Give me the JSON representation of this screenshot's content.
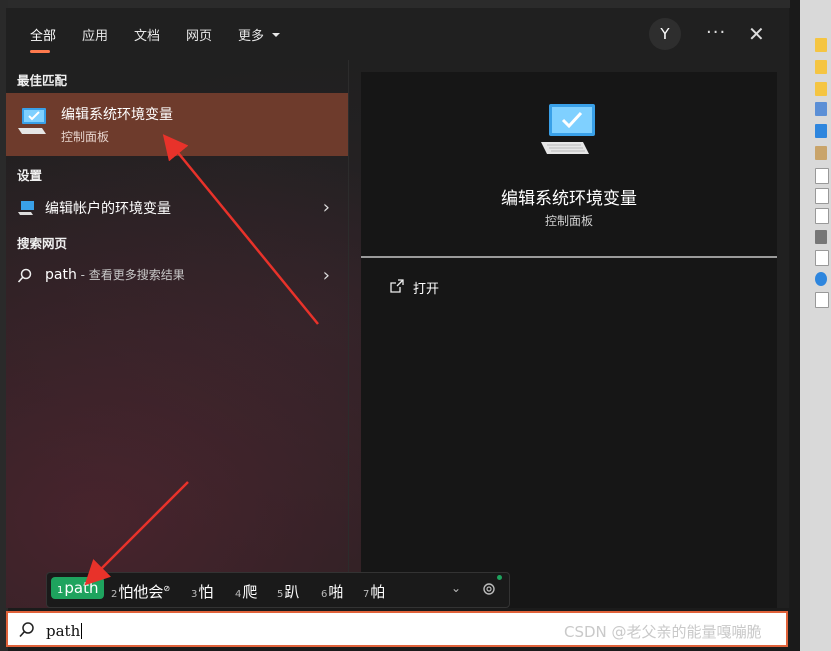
{
  "tabs": [
    {
      "label": "全部",
      "active": true
    },
    {
      "label": "应用"
    },
    {
      "label": "文档"
    },
    {
      "label": "网页"
    },
    {
      "label": "更多"
    }
  ],
  "header": {
    "avatar_initial": "Y",
    "more_icon": "ellipsis-icon",
    "close_icon": "close-icon"
  },
  "sections": {
    "best_match": "最佳匹配",
    "settings": "设置",
    "web_search": "搜索网页"
  },
  "best_match_item": {
    "title": "编辑系统环境变量",
    "subtitle": "控制面板",
    "icon": "monitor-check-icon"
  },
  "settings_item": {
    "label": "编辑帐户的环境变量",
    "icon": "monitor-icon"
  },
  "web_item": {
    "query": "path",
    "suffix": " - 查看更多搜索结果",
    "icon": "search-icon"
  },
  "detail": {
    "title": "编辑系统环境变量",
    "subtitle": "控制面板",
    "action_label": "打开",
    "action_icon": "open-external-icon"
  },
  "ime": {
    "candidates": [
      {
        "num": "1",
        "text": "path"
      },
      {
        "num": "2",
        "text": "怕他会"
      },
      {
        "num": "3",
        "text": "怕"
      },
      {
        "num": "4",
        "text": "爬"
      },
      {
        "num": "5",
        "text": "趴"
      },
      {
        "num": "6",
        "text": "啪"
      },
      {
        "num": "7",
        "text": "帕"
      }
    ]
  },
  "search": {
    "value": "path"
  },
  "watermark": "CSDN @老父亲的能量嘎嘣脆",
  "colors": {
    "accent": "#ff7a4d",
    "best_match_bg": "#6e3b2c",
    "ime_selected": "#1ea35e",
    "search_border": "#e0623a",
    "annotation": "#e8322a"
  }
}
